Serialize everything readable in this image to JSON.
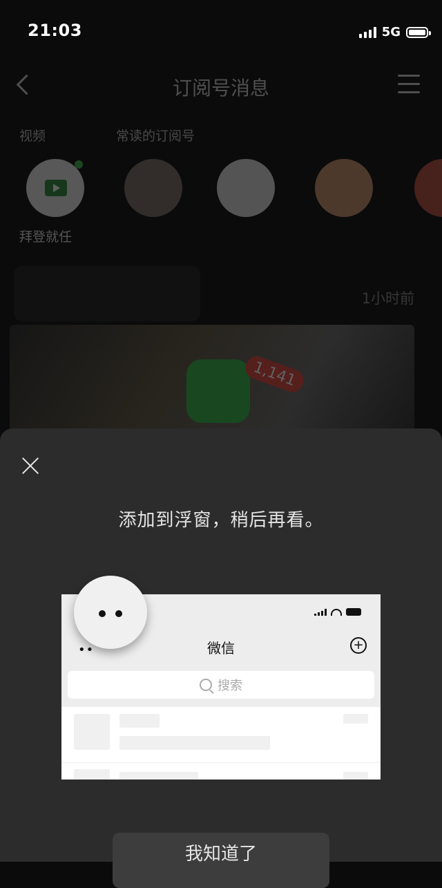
{
  "status_bar": {
    "time": "21:03",
    "network": "5G"
  },
  "background": {
    "nav_title": "订阅号消息",
    "section_video": "视频",
    "section_frequent": "常读的订阅号",
    "avatar_label": "拜登就任",
    "time_ago": "1小时前",
    "badge_count": "1,141"
  },
  "sheet": {
    "title": "添加到浮窗，稍后再看。",
    "confirm_label": "我知道了"
  },
  "illustration": {
    "title": "微信",
    "search_placeholder": "搜索",
    "left_dots": "••"
  },
  "icons": [
    "back-icon",
    "menu-icon",
    "play-icon",
    "close-icon",
    "float-bubble-icon",
    "plus-icon",
    "search-icon"
  ]
}
